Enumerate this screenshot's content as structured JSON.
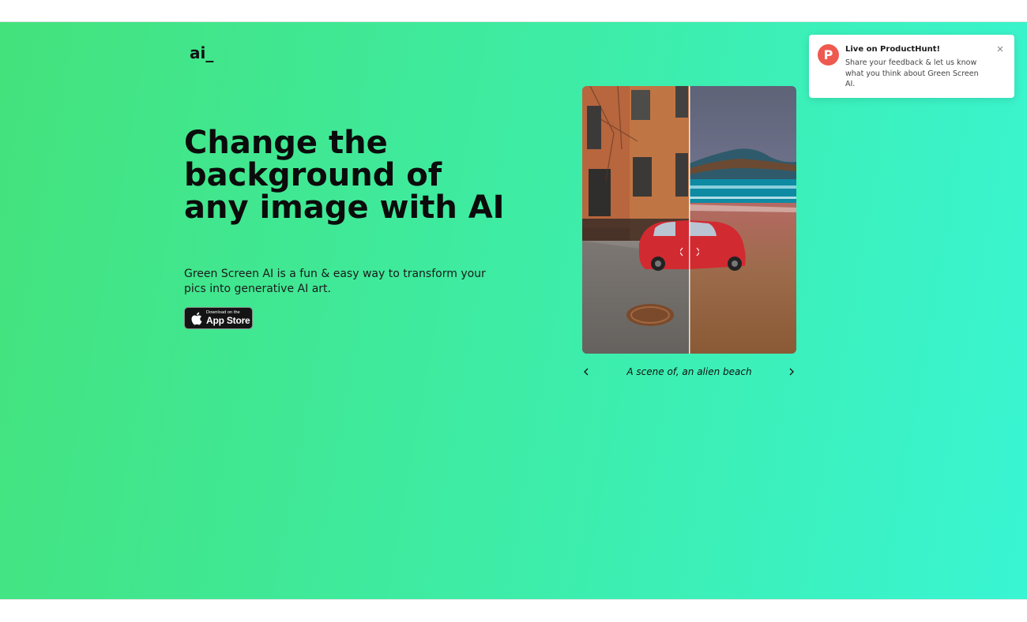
{
  "brand": {
    "logo_text": "ai_"
  },
  "hero": {
    "headline": "Change the background of any image with AI",
    "subtitle": "Green Screen AI is a fun & easy way to transform your pics into generative AI art.",
    "app_store": {
      "small_text": "Download on the",
      "big_text": "App Store"
    }
  },
  "carousel": {
    "caption": "A scene of, an alien beach",
    "prev_icon": "chevron-left-icon",
    "next_icon": "chevron-right-icon",
    "compare_handle_icon": "chevron-right-icon"
  },
  "toast": {
    "badge_letter": "P",
    "title": "Live on ProductHunt!",
    "body": "Share your feedback & let us know what you think about Green Screen AI.",
    "close_icon": "close-icon",
    "badge_color": "#ee5a4f"
  },
  "colors": {
    "gradient_start": "#44e27c",
    "gradient_end": "#39f5d3"
  }
}
